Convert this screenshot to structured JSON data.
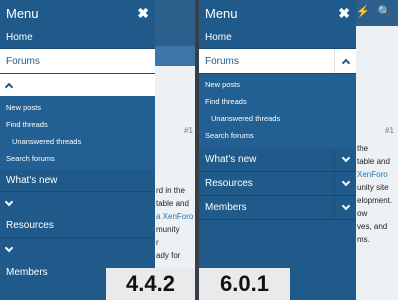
{
  "left": {
    "menu_title": "Menu",
    "close_glyph": "✖",
    "home": "Home",
    "forums": "Forums",
    "forum_sub": [
      "New posts",
      "Find threads",
      "Unanswered threads",
      "Search forums"
    ],
    "whats_new": "What's new",
    "resources": "Resources",
    "members": "Members",
    "badge": "4.4.2",
    "bg_post": [
      "rd in the",
      "table and",
      "a XenForo",
      "munity",
      "r",
      "ady for"
    ],
    "bg_num": "#1"
  },
  "right": {
    "menu_title": "Menu",
    "close_glyph": "✖",
    "home": "Home",
    "forums": "Forums",
    "forum_sub": [
      "New posts",
      "Find threads",
      "Unanswered threads",
      "Search forums"
    ],
    "whats_new": "What's new",
    "resources": "Resources",
    "members": "Members",
    "badge": "6.0.1",
    "bg_post": [
      "the",
      "table and",
      "XenForo",
      "unity site",
      "elopment.",
      "ow",
      "ves, and",
      "ms."
    ],
    "bg_num": "#1",
    "header_icons": [
      "lightning-icon",
      "search-icon"
    ]
  },
  "colors": {
    "panel": "#1f5a8a",
    "selected_bg": "#ffffff",
    "badge_bg": "#e8eaec"
  }
}
